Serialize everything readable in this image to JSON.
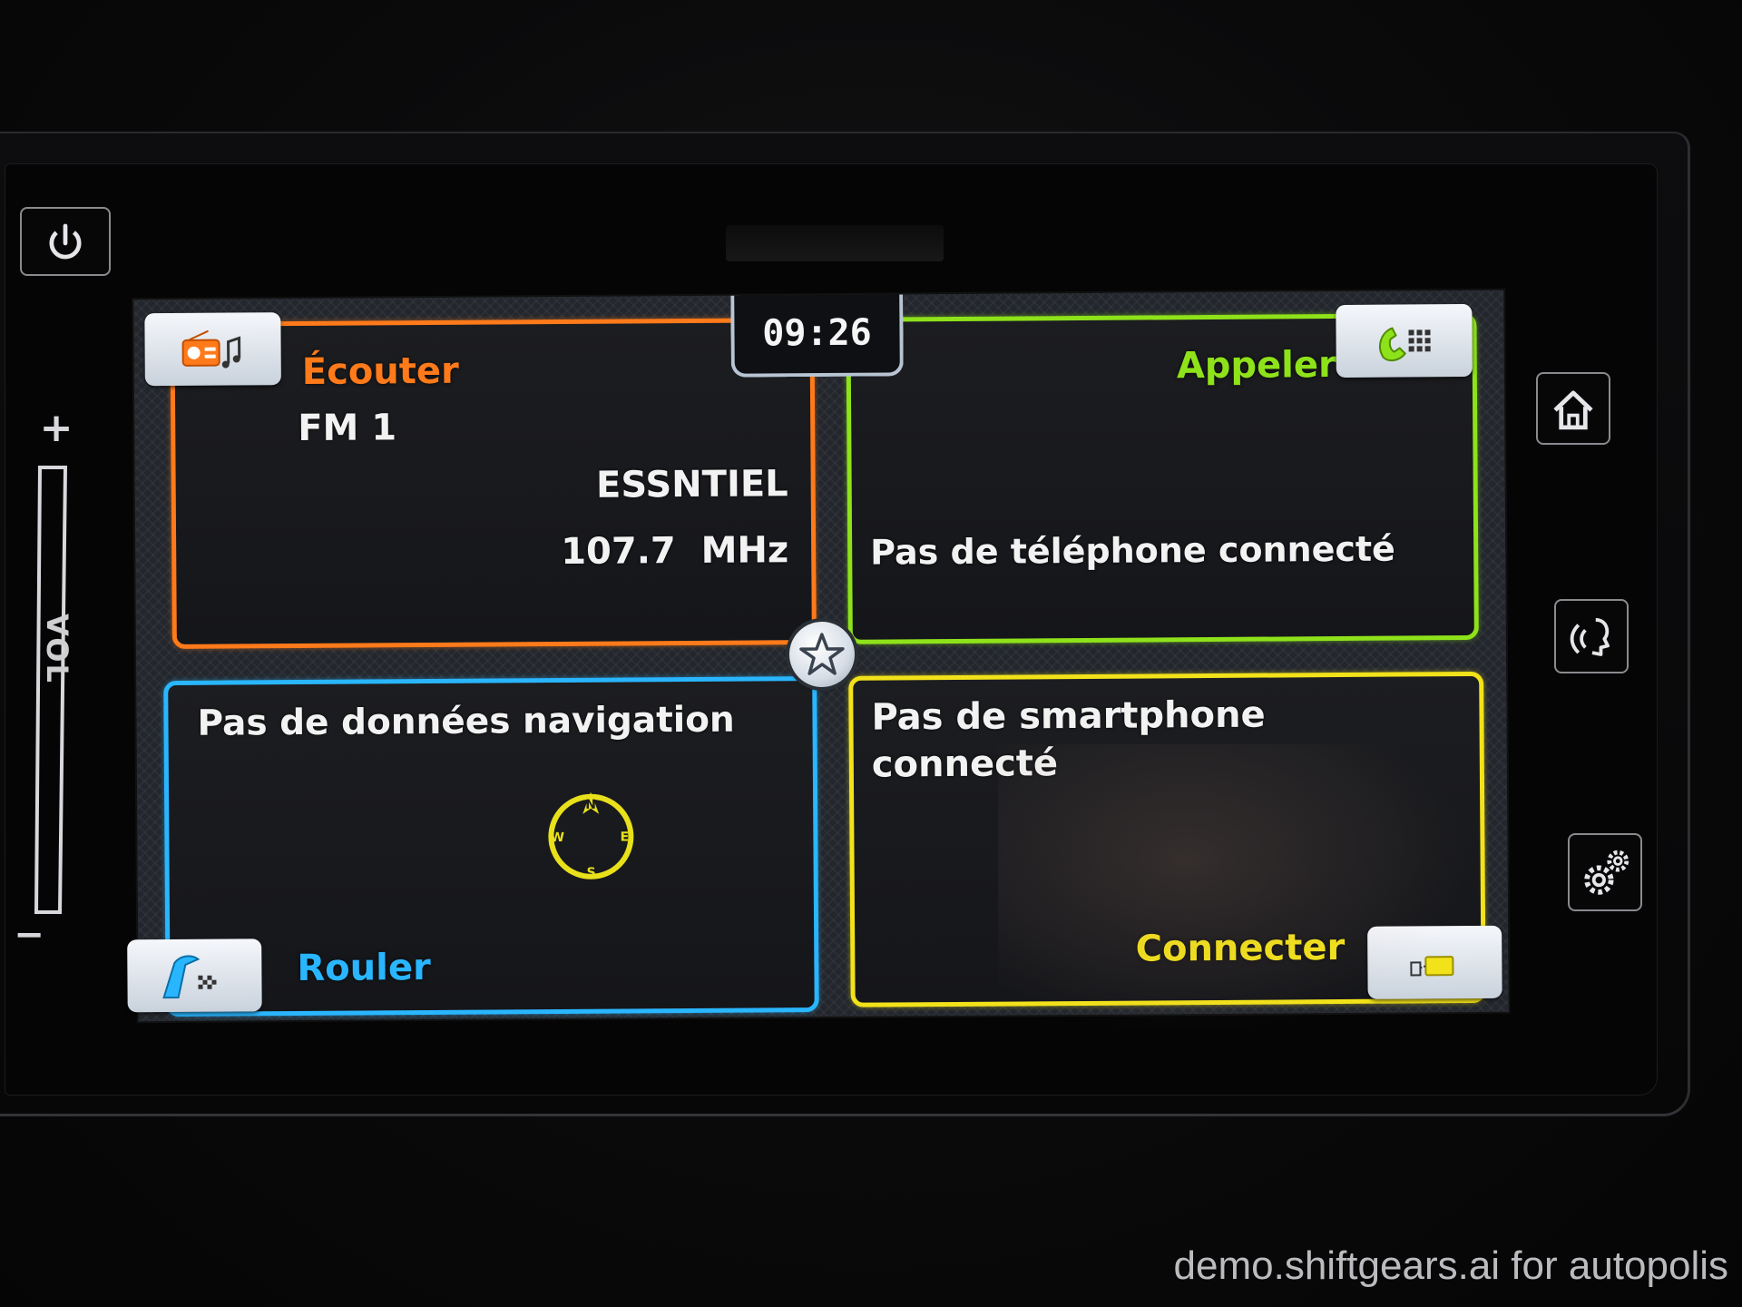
{
  "clock": {
    "time": "09:26"
  },
  "listen": {
    "title": "Écouter",
    "band": "FM 1",
    "station": "ESSNTIEL",
    "frequency": "107.7  MHz",
    "icon": "radio-music-icon",
    "color": "#ff7a1a"
  },
  "call": {
    "title": "Appeler",
    "status": "Pas de téléphone connecté",
    "icon": "phone-keypad-icon",
    "color": "#8ee21a"
  },
  "drive": {
    "title": "Rouler",
    "status": "Pas de données navigation",
    "icon": "road-flag-icon",
    "compass": {
      "n": "N",
      "e": "E",
      "s": "S",
      "w": "W"
    },
    "color": "#29b6ff"
  },
  "connect": {
    "title": "Connecter",
    "status_line1": "Pas de smartphone",
    "status_line2": "connecté",
    "icon": "device-link-icon",
    "color": "#f2e21a"
  },
  "favorites": {
    "icon": "star-icon"
  },
  "side_buttons": {
    "power_icon": "power-icon",
    "home_icon": "home-icon",
    "voice_icon": "voice-command-icon",
    "settings_icon": "gear-icon"
  },
  "volume": {
    "label": "VOL",
    "plus": "+",
    "minus": "−"
  },
  "watermark": "demo.shiftgears.ai for autopolis"
}
